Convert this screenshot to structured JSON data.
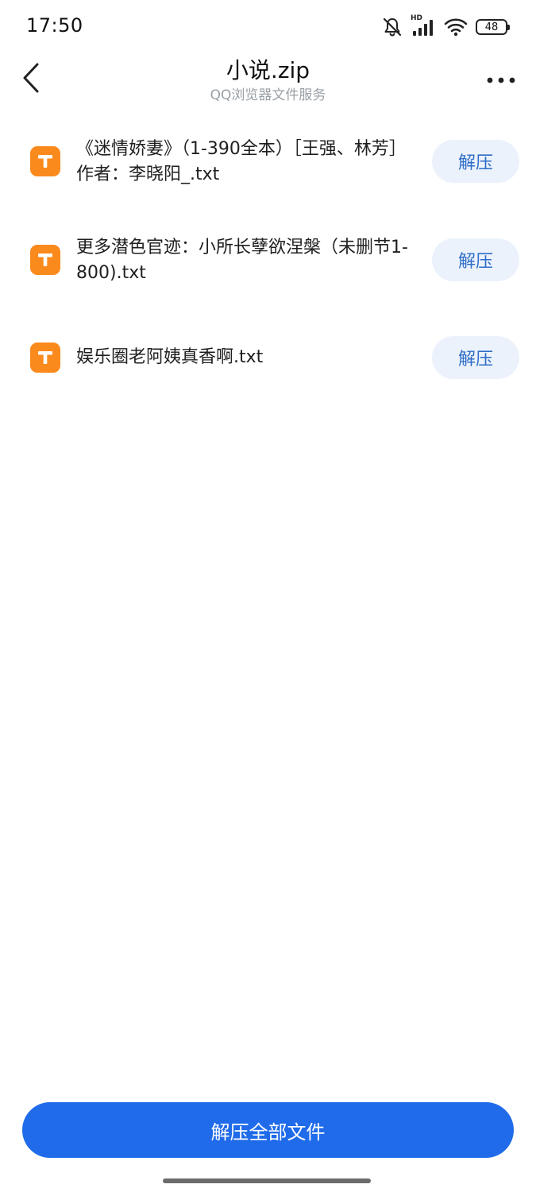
{
  "status_bar": {
    "time": "17:50",
    "battery": "48",
    "network_label": "HD",
    "icons": [
      "bell-muted-icon",
      "signal-icon",
      "wifi-icon",
      "battery-icon"
    ]
  },
  "header": {
    "title": "小说.zip",
    "subtitle": "QQ浏览器文件服务",
    "back_icon": "chevron-left-icon",
    "more_icon": "more-dots-icon"
  },
  "files": [
    {
      "name": "《迷情娇妻》（1-390全本）［王强、林芳］作者：李晓阳_.txt",
      "icon": "txt-file-icon",
      "action": "解压"
    },
    {
      "name": "更多潜色官迹：小所长孽欲涅槃（未删节1-800).txt",
      "icon": "txt-file-icon",
      "action": "解压"
    },
    {
      "name": "娱乐圈老阿姨真香啊.txt",
      "icon": "txt-file-icon",
      "action": "解压"
    }
  ],
  "footer": {
    "extract_all_label": "解压全部文件"
  },
  "colors": {
    "accent": "#1f6bea",
    "file_icon": "#fb8a1d",
    "button_bg": "#ebf2fc",
    "button_text": "#2f6ec7"
  }
}
